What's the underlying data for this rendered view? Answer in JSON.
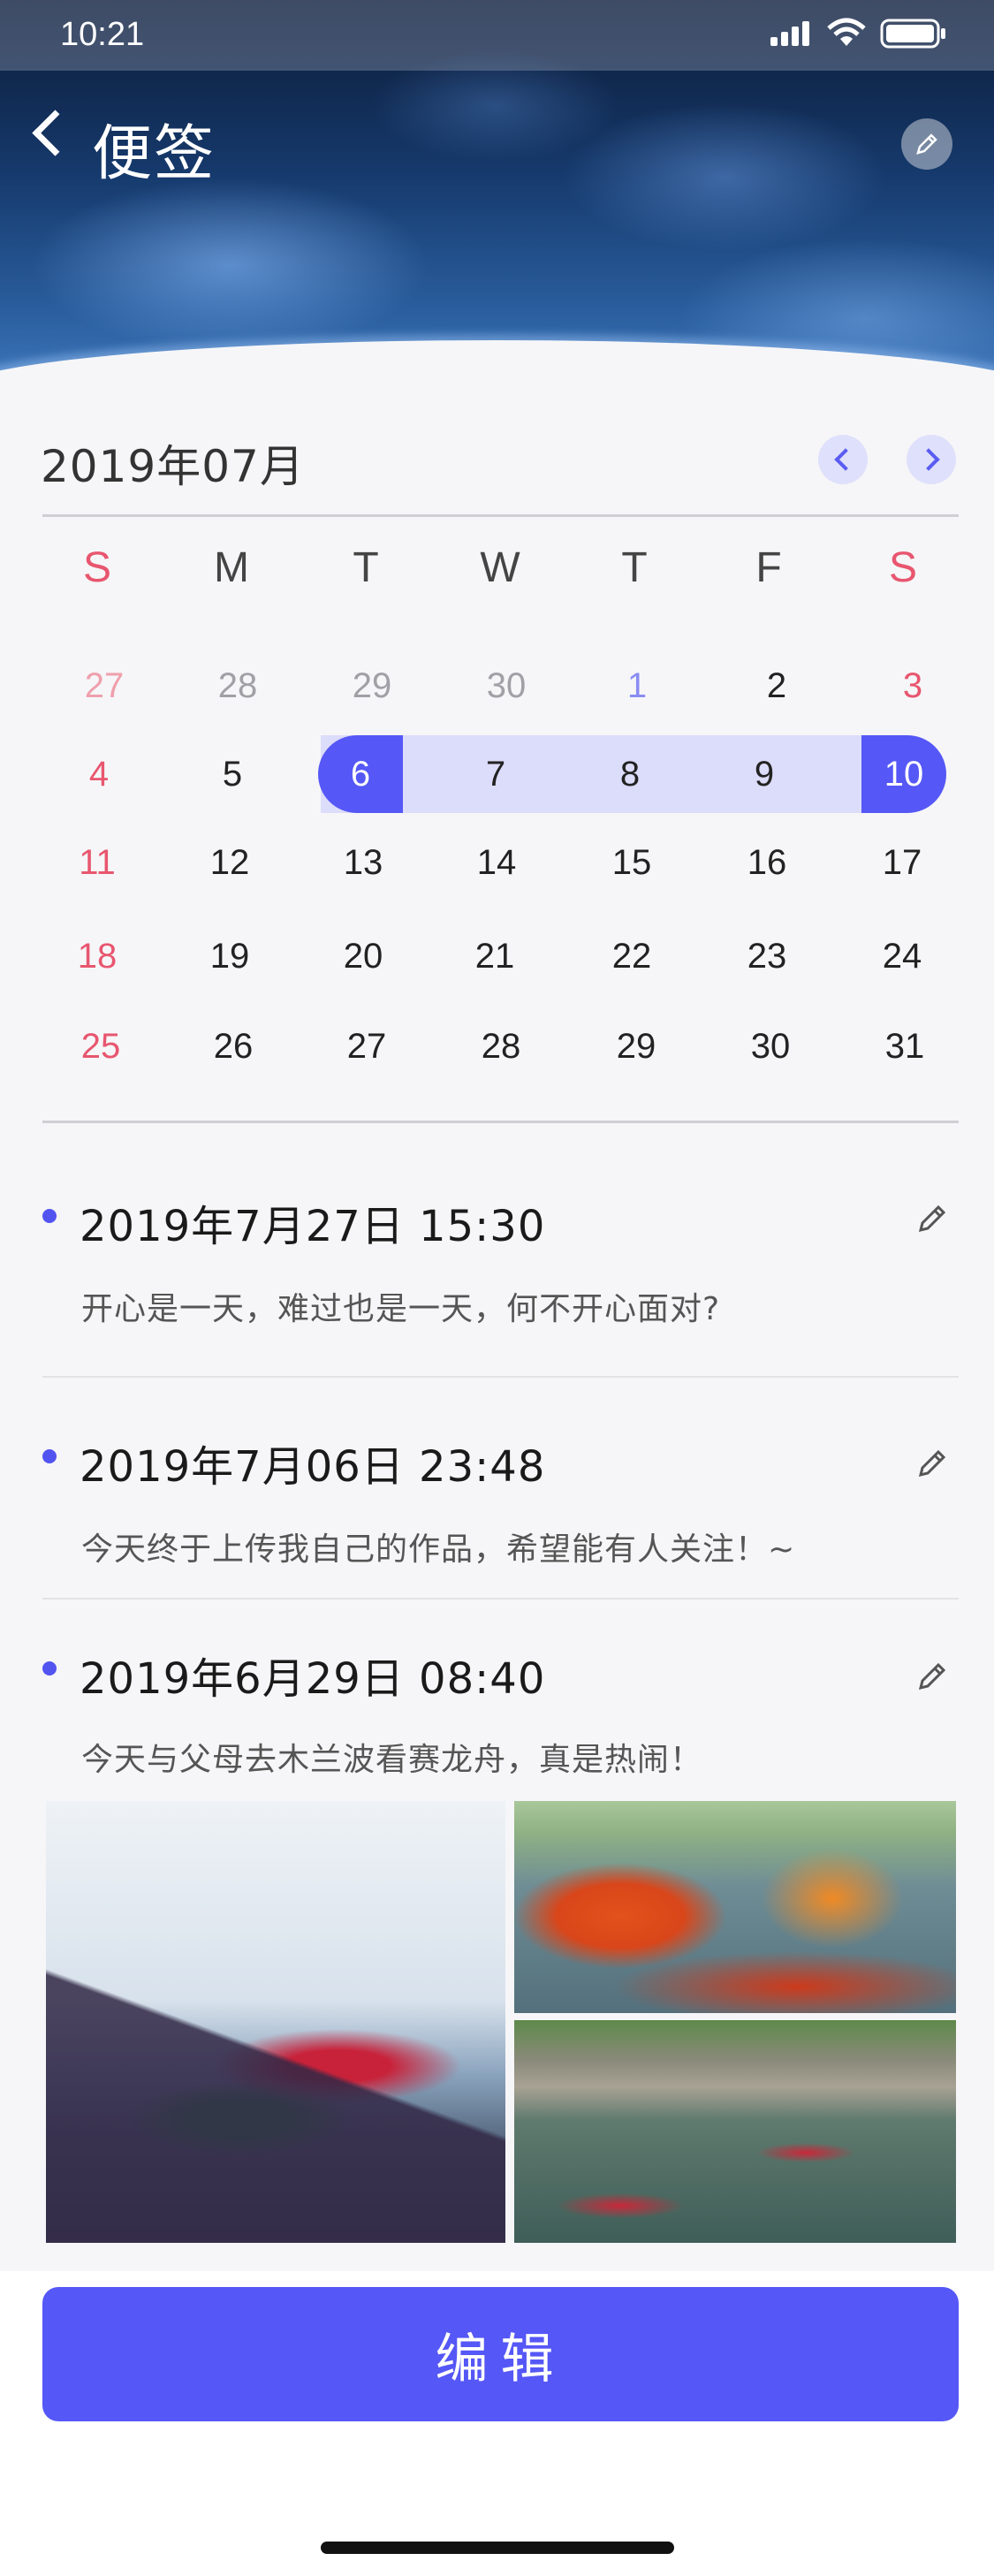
{
  "status_bar": {
    "time": "10:21"
  },
  "header": {
    "title": "便签"
  },
  "calendar": {
    "month_label": "2019年07月",
    "weekdays": [
      "S",
      "M",
      "T",
      "W",
      "T",
      "F",
      "S"
    ],
    "weeks": [
      [
        "27",
        "28",
        "29",
        "30",
        "1",
        "2",
        "3"
      ],
      [
        "4",
        "5",
        "6",
        "7",
        "8",
        "9",
        "10"
      ],
      [
        "11",
        "12",
        "13",
        "14",
        "15",
        "16",
        "17"
      ],
      [
        "18",
        "19",
        "20",
        "21",
        "22",
        "23",
        "24"
      ],
      [
        "25",
        "26",
        "27",
        "28",
        "29",
        "30",
        "31"
      ]
    ],
    "selected_range": {
      "start": "6",
      "end": "10"
    },
    "colors": {
      "accent": "#5557f6",
      "range_fill": "#dcdcfb",
      "weekend": "#e8566f"
    }
  },
  "notes": [
    {
      "title": "2019年7月27日 15:30",
      "body": "开心是一天，难过也是一天，何不开心面对?"
    },
    {
      "title": "2019年7月06日 23:48",
      "body": "今天终于上传我自己的作品，希望能有人关注！~"
    },
    {
      "title": "2019年6月29日 08:40",
      "body": "今天与父母去木兰波看赛龙舟，真是热闹！"
    }
  ],
  "bottom": {
    "edit_label": "编辑"
  },
  "icons": {
    "back": "chevron-left-icon",
    "edit": "pencil-icon",
    "prev": "chevron-left-icon",
    "next": "chevron-right-icon"
  }
}
